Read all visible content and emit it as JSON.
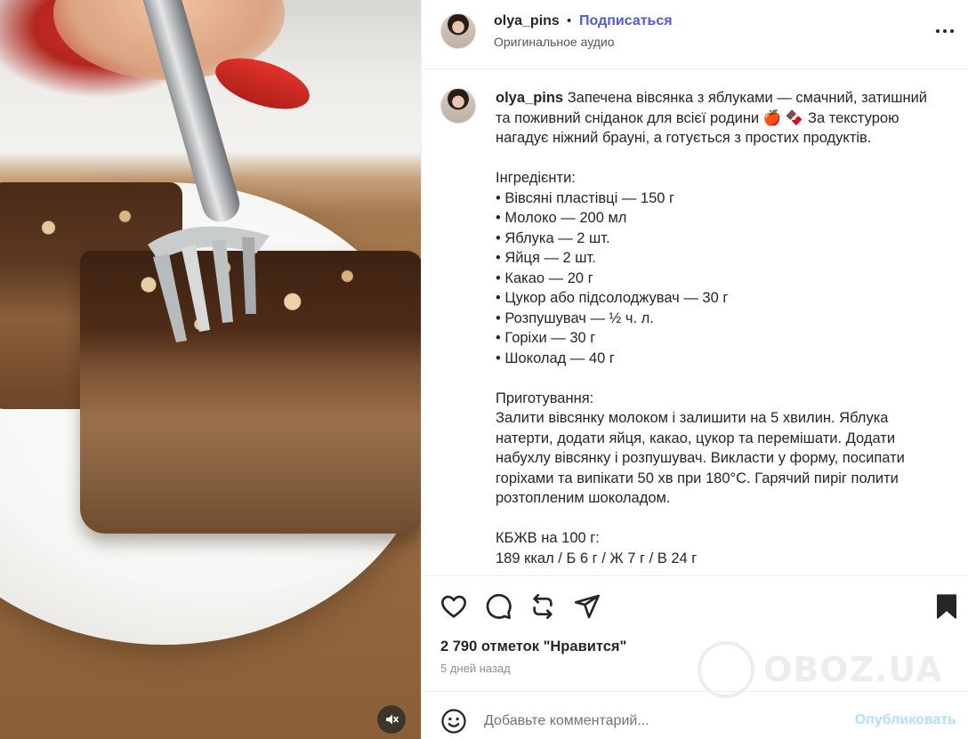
{
  "post": {
    "username": "olya_pins",
    "follow_label": "Подписаться",
    "separator": "•",
    "audio_label": "Оригинальное аудио"
  },
  "caption": {
    "username": "olya_pins",
    "lines": [
      " Запечена вівсянка з яблуками — смачний, затишний",
      "та поживний сніданок для всієї родини 🍎 🍫 За текстурою",
      "нагадує ніжний брауні, а готується з простих продуктів."
    ],
    "ingredients_title": "Інгредієнти:",
    "ingredients": [
      "• Вівсяні пластівці — 150 г",
      "• Молоко — 200 мл",
      "• Яблука — 2 шт.",
      "• Яйця — 2 шт.",
      "• Какао — 20 г",
      "• Цукор або підсолоджувач — 30 г",
      "• Розпушувач — ½ ч. л.",
      "• Горіхи — 30 г",
      "• Шоколад — 40 г"
    ],
    "method_title": "Приготування:",
    "method": [
      "Залити вівсянку молоком і залишити на 5 хвилин. Яблука",
      "натерти, додати яйця, какао, цукор та перемішати. Додати",
      "набухлу вівсянку і розпушувач. Викласти у форму, посипати",
      "горіхами та випікати 50 хв при 180°C. Гарячий пиріг полити",
      "розтопленим шоколадом."
    ],
    "nutrition_title": "КБЖВ на 100 г:",
    "nutrition": "189 ккал / Б 6 г / Ж 7 г / В 24 г"
  },
  "engagement": {
    "likes_label": "2 790 отметок \"Нравится\"",
    "time_label": "5 дней назад"
  },
  "comment": {
    "placeholder": "Добавьте комментарий...",
    "publish_label": "Опубликовать"
  },
  "icons": {
    "like": "heart-icon",
    "comment": "comment-icon",
    "repost": "repost-icon",
    "share": "send-icon",
    "save": "bookmark-icon",
    "emoji": "emoji-icon",
    "mute": "speaker-muted-icon",
    "more": "more-icon"
  },
  "watermark": "OBOZ.UA",
  "colors": {
    "follow": "#4f5bd5",
    "publish_disabled": "#b2dffc",
    "text": "#262626",
    "secondary": "#8e8e8e"
  }
}
